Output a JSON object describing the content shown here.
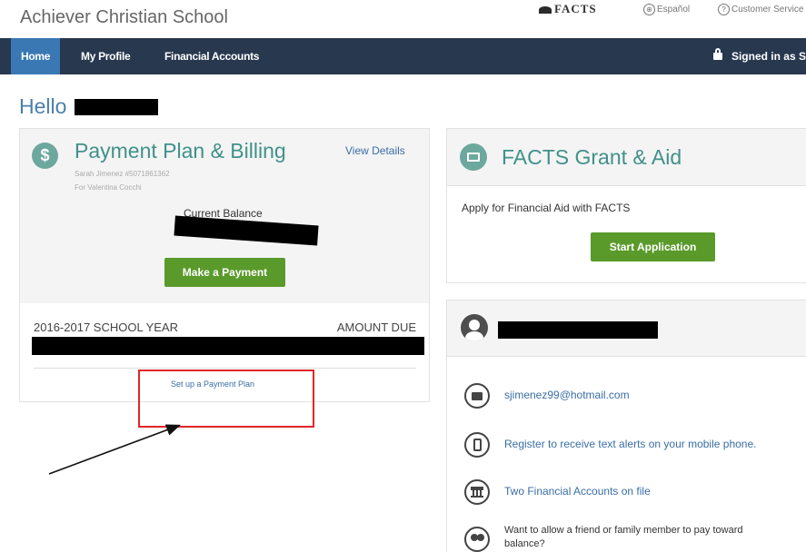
{
  "header": {
    "school_name": "Achiever Christian School",
    "facts_logo": "FACTS",
    "espanol": "Español",
    "customer_service": "Customer Service"
  },
  "nav": {
    "home": "Home",
    "my_profile": "My Profile",
    "financial_accounts": "Financial Accounts",
    "signed_in": "Signed in as S"
  },
  "greeting": "Hello",
  "payment_plan": {
    "title": "Payment Plan & Billing",
    "view_details": "View Details",
    "account_line": "Sarah Jimenez #5071861362",
    "for_line": "For Valentina Cocchi",
    "current_balance_label": "Current Balance",
    "make_payment": "Make a Payment",
    "school_year": "2016-2017 SCHOOL YEAR",
    "amount_due": "AMOUNT DUE",
    "setup_plan": "Set up a Payment Plan"
  },
  "grant": {
    "title": "FACTS Grant & Aid",
    "description": "Apply for Financial Aid with FACTS",
    "start_application": "Start Application"
  },
  "contact": {
    "email": "sjimenez99@hotmail.com",
    "text_alerts": "Register to receive text alerts on your mobile phone.",
    "accounts": "Two Financial Accounts on file",
    "friend_line1": "Want to allow a friend or family member to pay toward",
    "friend_line2": "balance?"
  },
  "colors": {
    "nav_bg": "#27384f",
    "nav_active": "#3a78b4",
    "teal": "#41918a",
    "button_green": "#5a9a2b",
    "link_blue": "#3a6ea5",
    "annotation_red": "#e0262a"
  }
}
